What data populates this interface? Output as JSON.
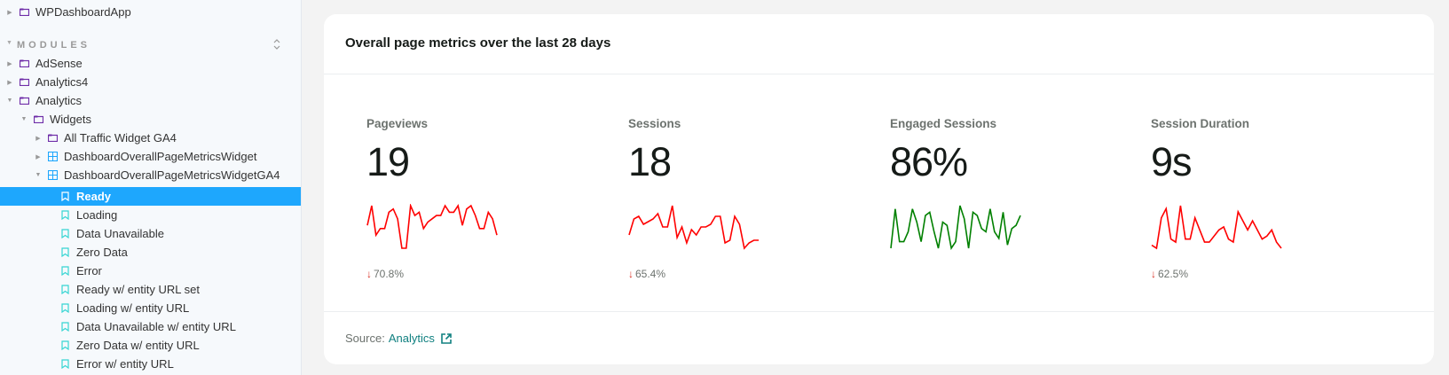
{
  "sidebar": {
    "top_item": {
      "label": "WPDashboardApp"
    },
    "modules_label": "MODULES",
    "items": [
      {
        "label": "AdSense"
      },
      {
        "label": "Analytics4"
      },
      {
        "label": "Analytics"
      },
      {
        "label": "Widgets"
      },
      {
        "label": "All Traffic Widget GA4"
      },
      {
        "label": "DashboardOverallPageMetricsWidget"
      },
      {
        "label": "DashboardOverallPageMetricsWidgetGA4"
      },
      {
        "label": "Ready"
      },
      {
        "label": "Loading"
      },
      {
        "label": "Data Unavailable"
      },
      {
        "label": "Zero Data"
      },
      {
        "label": "Error"
      },
      {
        "label": "Ready w/ entity URL set"
      },
      {
        "label": "Loading w/ entity URL"
      },
      {
        "label": "Data Unavailable w/ entity URL"
      },
      {
        "label": "Zero Data w/ entity URL"
      },
      {
        "label": "Error w/ entity URL"
      }
    ]
  },
  "widget": {
    "title": "Overall page metrics over the last 28 days",
    "metrics": [
      {
        "label": "Pageviews",
        "value": "19",
        "change": "70.8%",
        "color": "#ff0000",
        "trend": [
          5,
          11,
          2,
          4,
          4,
          9,
          10,
          7,
          -2,
          -2,
          11,
          8,
          9,
          4,
          6,
          7,
          8,
          8,
          11,
          9,
          9,
          11,
          5,
          10,
          11,
          8,
          4,
          4,
          9,
          7,
          2
        ]
      },
      {
        "label": "Sessions",
        "value": "18",
        "change": "65.4%",
        "color": "#ff0000",
        "trend": [
          3,
          9,
          10,
          7,
          8,
          9,
          11,
          6,
          6,
          14,
          2,
          6,
          0,
          5,
          3,
          6,
          6,
          7,
          10,
          10,
          0,
          1,
          10,
          7,
          -2,
          0,
          1,
          1
        ]
      },
      {
        "label": "Engaged Sessions",
        "value": "86%",
        "change": "",
        "color": "#008000",
        "trend": [
          0,
          12,
          2,
          2,
          5,
          12,
          8,
          2,
          10,
          11,
          5,
          0,
          8,
          7,
          0,
          2,
          13,
          9,
          0,
          11,
          10,
          6,
          5,
          12,
          5,
          3,
          11,
          1,
          6,
          7,
          10
        ]
      },
      {
        "label": "Session Duration",
        "value": "9s",
        "change": "62.5%",
        "color": "#ff0000",
        "trend": [
          0,
          -1,
          9,
          12,
          2,
          1,
          13,
          2,
          2,
          9,
          5,
          1,
          1,
          3,
          5,
          6,
          2,
          1,
          11,
          8,
          5,
          8,
          5,
          2,
          3,
          5,
          1,
          -1
        ]
      }
    ],
    "source_label": "Source:",
    "source_link": "Analytics"
  },
  "colors": {
    "accent": "#1ea7fd",
    "link": "#108080",
    "down": "#d93025"
  }
}
